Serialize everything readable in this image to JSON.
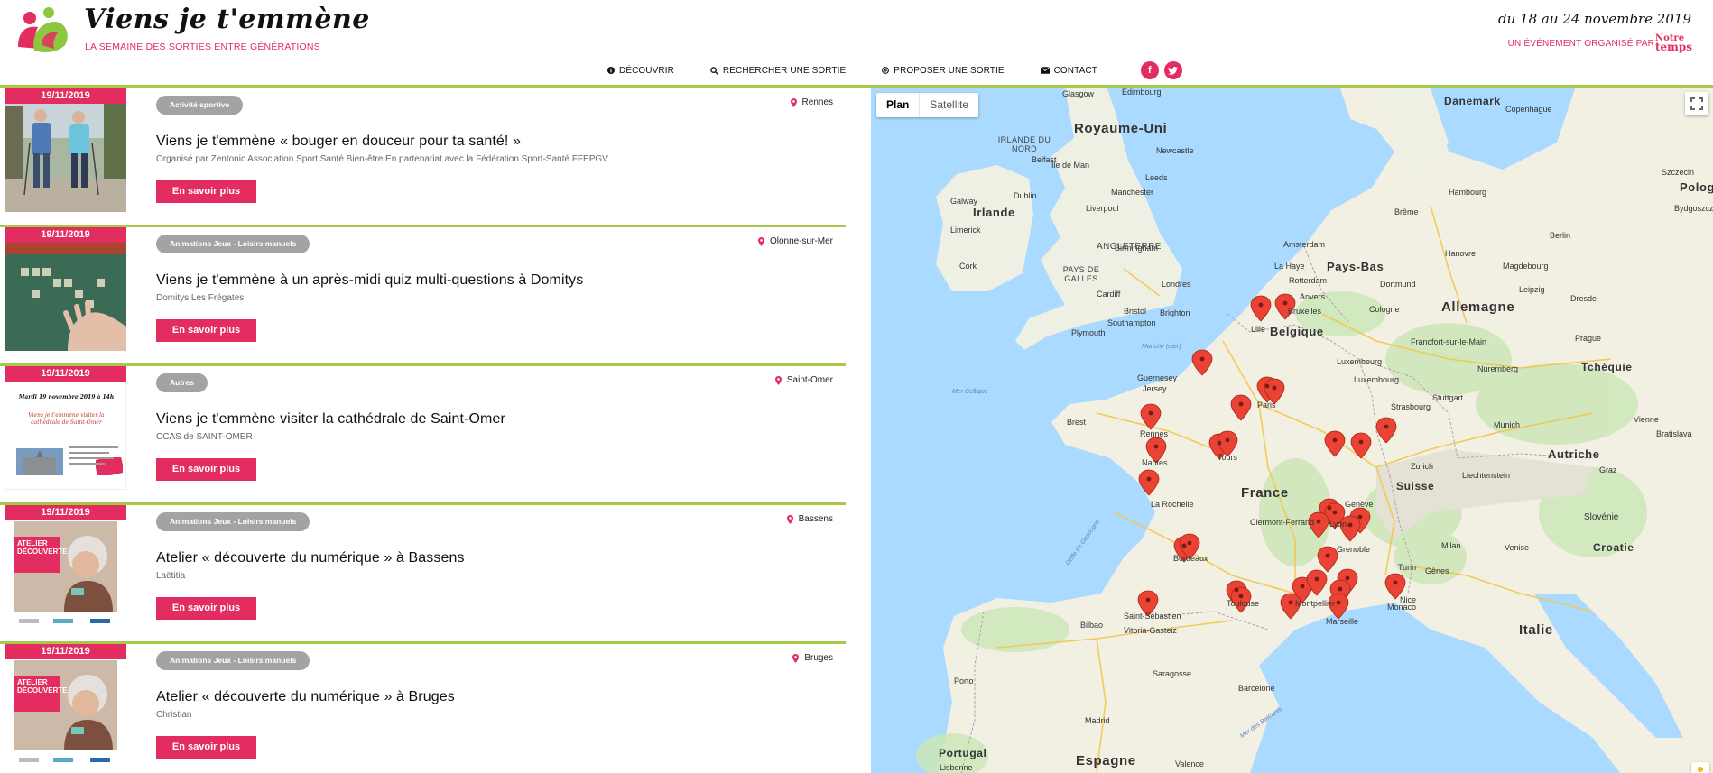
{
  "header": {
    "title": "Viens je t'emmène",
    "tagline": "LA SEMAINE DES SORTIES ENTRE GÉNÉRATIONS",
    "dates": "du 18 au 24 novembre 2019",
    "organizer_prefix": "UN ÉVÉNEMENT ORGANISÉ PAR",
    "organizer_brand_line1": "Notre",
    "organizer_brand_line2": "temps"
  },
  "nav": {
    "items": [
      {
        "label": "DÉCOUVRIR",
        "icon": "info-icon"
      },
      {
        "label": "RECHERCHER UNE SORTIE",
        "icon": "search-icon"
      },
      {
        "label": "PROPOSER UNE SORTIE",
        "icon": "plus-circle-icon"
      },
      {
        "label": "CONTACT",
        "icon": "envelope-icon"
      }
    ],
    "social": [
      "facebook-icon",
      "twitter-icon"
    ]
  },
  "colors": {
    "accent": "#e32c5f",
    "green": "#a8c84a",
    "pill": "#a3a3a3"
  },
  "events": [
    {
      "date": "19/11/2019",
      "category": "Activité sportive",
      "location": "Rennes",
      "title": "Viens je t'emmène « bouger en douceur pour ta santé! »",
      "organizer": "Organisé par Zentonic Association Sport Santé Bien-être En partenariat avec la Fédération Sport-Santé FFEPGV",
      "button": "En savoir plus"
    },
    {
      "date": "19/11/2019",
      "category": "Animations Jeux - Loisirs manuels",
      "location": "Olonne-sur-Mer",
      "title": "Viens je t'emmène à un après-midi quiz multi-questions à Domitys",
      "organizer": "Domitys Les Frégates",
      "button": "En savoir plus"
    },
    {
      "date": "19/11/2019",
      "category": "Autres",
      "location": "Saint-Omer",
      "title": "Viens je t'emmène visiter la cathédrale de Saint-Omer",
      "organizer": "CCAS de SAINT-OMER",
      "button": "En savoir plus",
      "thumb_line1": "Mardi 19 novembre 2019 à 14h",
      "thumb_line2": "Viens je t'emmène visiter la cathédrale de Saint-Omer"
    },
    {
      "date": "19/11/2019",
      "category": "Animations Jeux - Loisirs manuels",
      "location": "Bassens",
      "title": "Atelier « découverte du numérique » à Bassens",
      "organizer": "Laëtitia",
      "button": "En savoir plus",
      "thumb_line1": "ATELIER",
      "thumb_line2": "DÉCOUVERTE"
    },
    {
      "date": "19/11/2019",
      "category": "Animations Jeux - Loisirs manuels",
      "location": "Bruges",
      "title": "Atelier « découverte du numérique » à Bruges",
      "organizer": "Christian",
      "button": "En savoir plus",
      "thumb_line1": "ATELIER",
      "thumb_line2": "DÉCOUVERTE"
    }
  ],
  "map": {
    "type_plan": "Plan",
    "type_satellite": "Satellite",
    "countries": [
      "Royaume-Uni",
      "Irlande",
      "Pays-Bas",
      "Belgique",
      "Allemagne",
      "France",
      "Suisse",
      "Autriche",
      "Tchéquie",
      "Pologne",
      "Italie",
      "Espagne",
      "Portugal",
      "Croatie",
      "Slovénie",
      "Danemark",
      "Luxembourg",
      "Liechtenstein",
      "Monaco"
    ],
    "regions": [
      "ANGLETERRE",
      "PAYS DE GALLES",
      "IRLANDE DU NORD"
    ],
    "cities": [
      "Glasgow",
      "Edimbourg",
      "Newcastle",
      "Île de Man",
      "Belfast",
      "Dublin",
      "Galway",
      "Leeds",
      "Manchester",
      "Liverpool",
      "Limerick",
      "Cork",
      "Birmingham",
      "Cardiff",
      "Londres",
      "Bristol",
      "Southampton",
      "Brighton",
      "Plymouth",
      "Amsterdam",
      "La Haye",
      "Rotterdam",
      "Anvers",
      "Bruxelles",
      "Lille",
      "Cologne",
      "Dortmund",
      "Hambourg",
      "Brême",
      "Berlin",
      "Hanovre",
      "Magdebourg",
      "Leipzig",
      "Dresde",
      "Francfort-sur-le-Main",
      "Nuremberg",
      "Stuttgart",
      "Munich",
      "Strasbourg",
      "Paris",
      "Rennes",
      "Nantes",
      "Tours",
      "La Rochelle",
      "Bordeaux",
      "Toulouse",
      "Montpellier",
      "Marseille",
      "Nice",
      "Lyon",
      "Genève",
      "Grenoble",
      "Clermont-Ferrand",
      "Bilbao",
      "Vitoria-Gasteiz",
      "Saint-Sébastien",
      "Saragosse",
      "Barcelone",
      "Madrid",
      "Valence",
      "Porto",
      "Lisbonne",
      "Milan",
      "Turin",
      "Gênes",
      "Venise",
      "Prague",
      "Vienne",
      "Bratislava",
      "Graz",
      "Zurich",
      "Luxembourg",
      "Brest",
      "Guernesey",
      "Jersey",
      "Copenhague",
      "Szczecin",
      "Bydgoszcz"
    ],
    "seas": [
      "Mer Celtique",
      "Manche (mer)",
      "Golfe de Gascogne",
      "Mer des Baléares"
    ]
  }
}
